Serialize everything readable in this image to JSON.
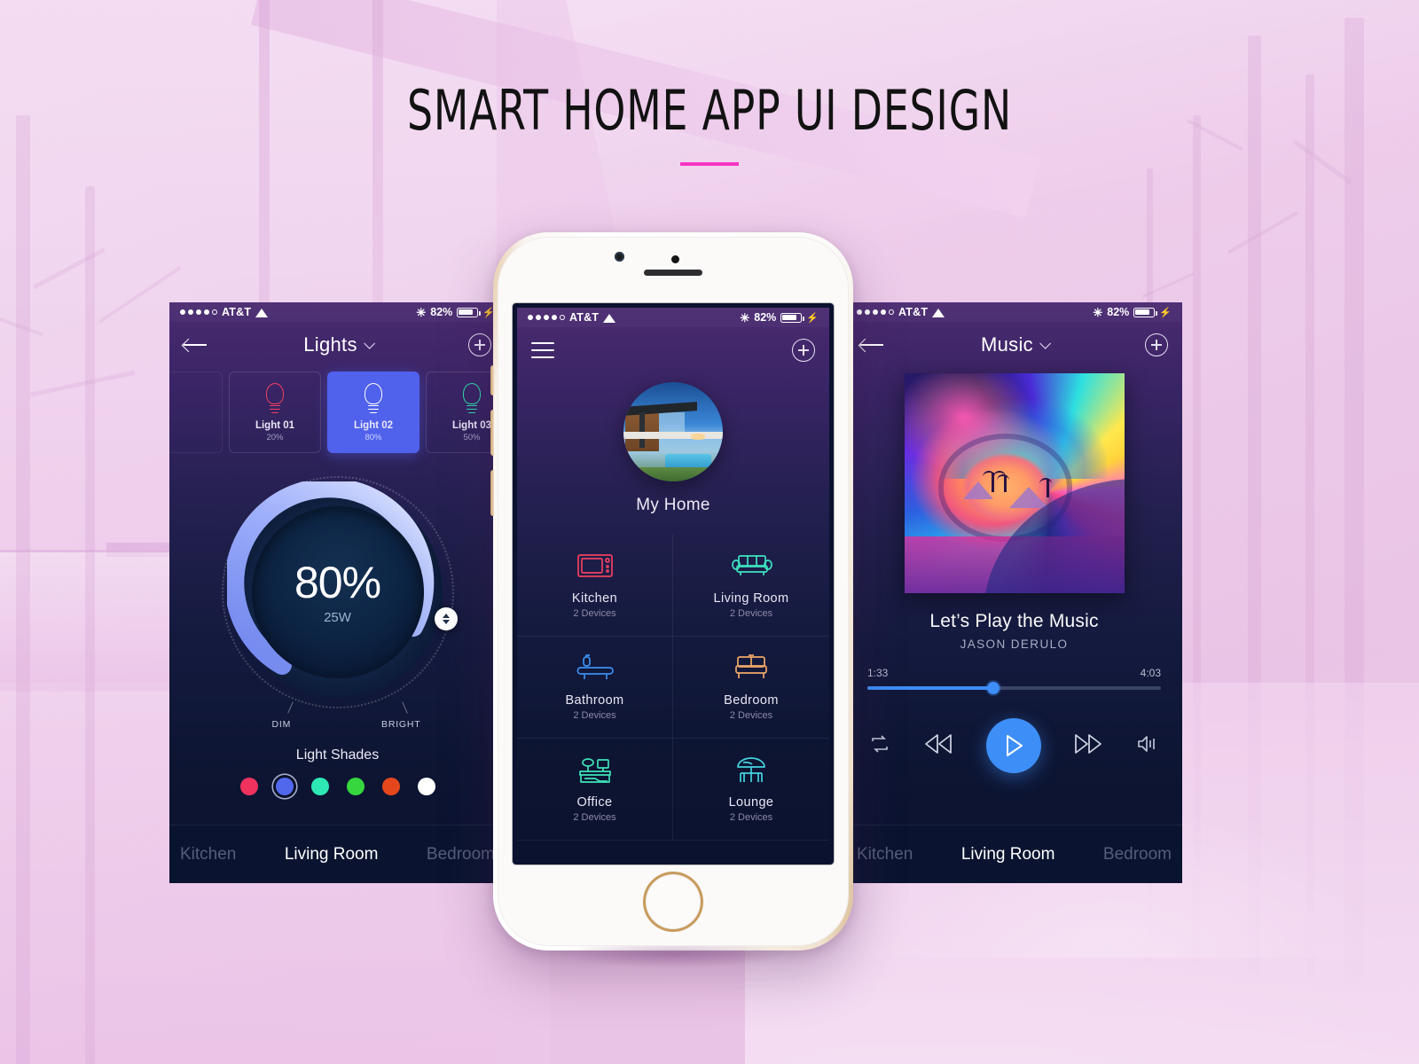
{
  "headline": {
    "title": "SMART HOME APP UI DESIGN"
  },
  "statusbar": {
    "carrier": "AT&T",
    "battery_pct": "82%",
    "bluetooth_icon": "bluetooth-icon",
    "wifi_icon": "wifi-icon",
    "charging_icon": "lightning-bolt-icon"
  },
  "lights_screen": {
    "nav": {
      "back_icon": "arrow-left-icon",
      "title": "Lights",
      "dropdown_icon": "chevron-down-icon",
      "add_icon": "plus-circle-icon"
    },
    "cards": [
      {
        "name": "Light 01",
        "pct": "20%",
        "color": "#ef4060",
        "active": false
      },
      {
        "name": "Light 02",
        "pct": "80%",
        "color": "#ffffff",
        "active": true
      },
      {
        "name": "Light 03",
        "pct": "50%",
        "color": "#2fd9ab",
        "active": false
      }
    ],
    "dial": {
      "value": "80%",
      "power": "25W",
      "min_label": "DIM",
      "max_label": "BRIGHT",
      "percent": 80,
      "arc_color": "#93a6f5",
      "handle_icon": "updown-arrows-icon"
    },
    "shades_title": "Light Shades",
    "shades": [
      {
        "name": "pink",
        "hex": "#f0325f",
        "selected": false
      },
      {
        "name": "blue",
        "hex": "#5268ec",
        "selected": true
      },
      {
        "name": "mint",
        "hex": "#2ee8b4",
        "selected": false
      },
      {
        "name": "green",
        "hex": "#36d63f",
        "selected": false
      },
      {
        "name": "orange",
        "hex": "#e5471c",
        "selected": false
      },
      {
        "name": "white",
        "hex": "#ffffff",
        "selected": false
      }
    ],
    "tabs": [
      {
        "label": "Kitchen",
        "active": false
      },
      {
        "label": "Living Room",
        "active": true
      },
      {
        "label": "Bedroom",
        "active": false
      }
    ]
  },
  "home_screen": {
    "nav": {
      "menu_icon": "hamburger-menu-icon",
      "add_icon": "plus-circle-icon"
    },
    "home_name": "My Home",
    "avatar_alt": "house-photo",
    "rooms": [
      {
        "name": "Kitchen",
        "devices": "2 Devices",
        "icon": "microwave-icon",
        "color": "#ef4060"
      },
      {
        "name": "Living Room",
        "devices": "2 Devices",
        "icon": "sofa-icon",
        "color": "#3fe3c0"
      },
      {
        "name": "Bathroom",
        "devices": "2 Devices",
        "icon": "bathtub-icon",
        "color": "#3d8ff0"
      },
      {
        "name": "Bedroom",
        "devices": "2 Devices",
        "icon": "bed-icon",
        "color": "#f0a868"
      },
      {
        "name": "Office",
        "devices": "2 Devices",
        "icon": "desk-icon",
        "color": "#3fe3b8"
      },
      {
        "name": "Lounge",
        "devices": "2 Devices",
        "icon": "patio-table-icon",
        "color": "#45d3e0"
      }
    ]
  },
  "music_screen": {
    "nav": {
      "back_icon": "arrow-left-icon",
      "title": "Music",
      "dropdown_icon": "chevron-down-icon",
      "add_icon": "plus-circle-icon"
    },
    "album_art_alt": "wave-sunset-album-art",
    "track_title": "Let’s Play the Music",
    "artist": "JASON DERULO",
    "elapsed": "1:33",
    "duration": "4:03",
    "progress_pct": 43,
    "accent": "#3e8ef7",
    "controls": [
      {
        "name": "repeat-button",
        "icon": "repeat-icon"
      },
      {
        "name": "rewind-button",
        "icon": "rewind-icon"
      },
      {
        "name": "play-button",
        "icon": "play-icon"
      },
      {
        "name": "forward-button",
        "icon": "fast-forward-icon"
      },
      {
        "name": "volume-button",
        "icon": "speaker-icon"
      }
    ],
    "tabs": [
      {
        "label": "Kitchen",
        "active": false
      },
      {
        "label": "Living Room",
        "active": true
      },
      {
        "label": "Bedroom",
        "active": false
      }
    ]
  }
}
